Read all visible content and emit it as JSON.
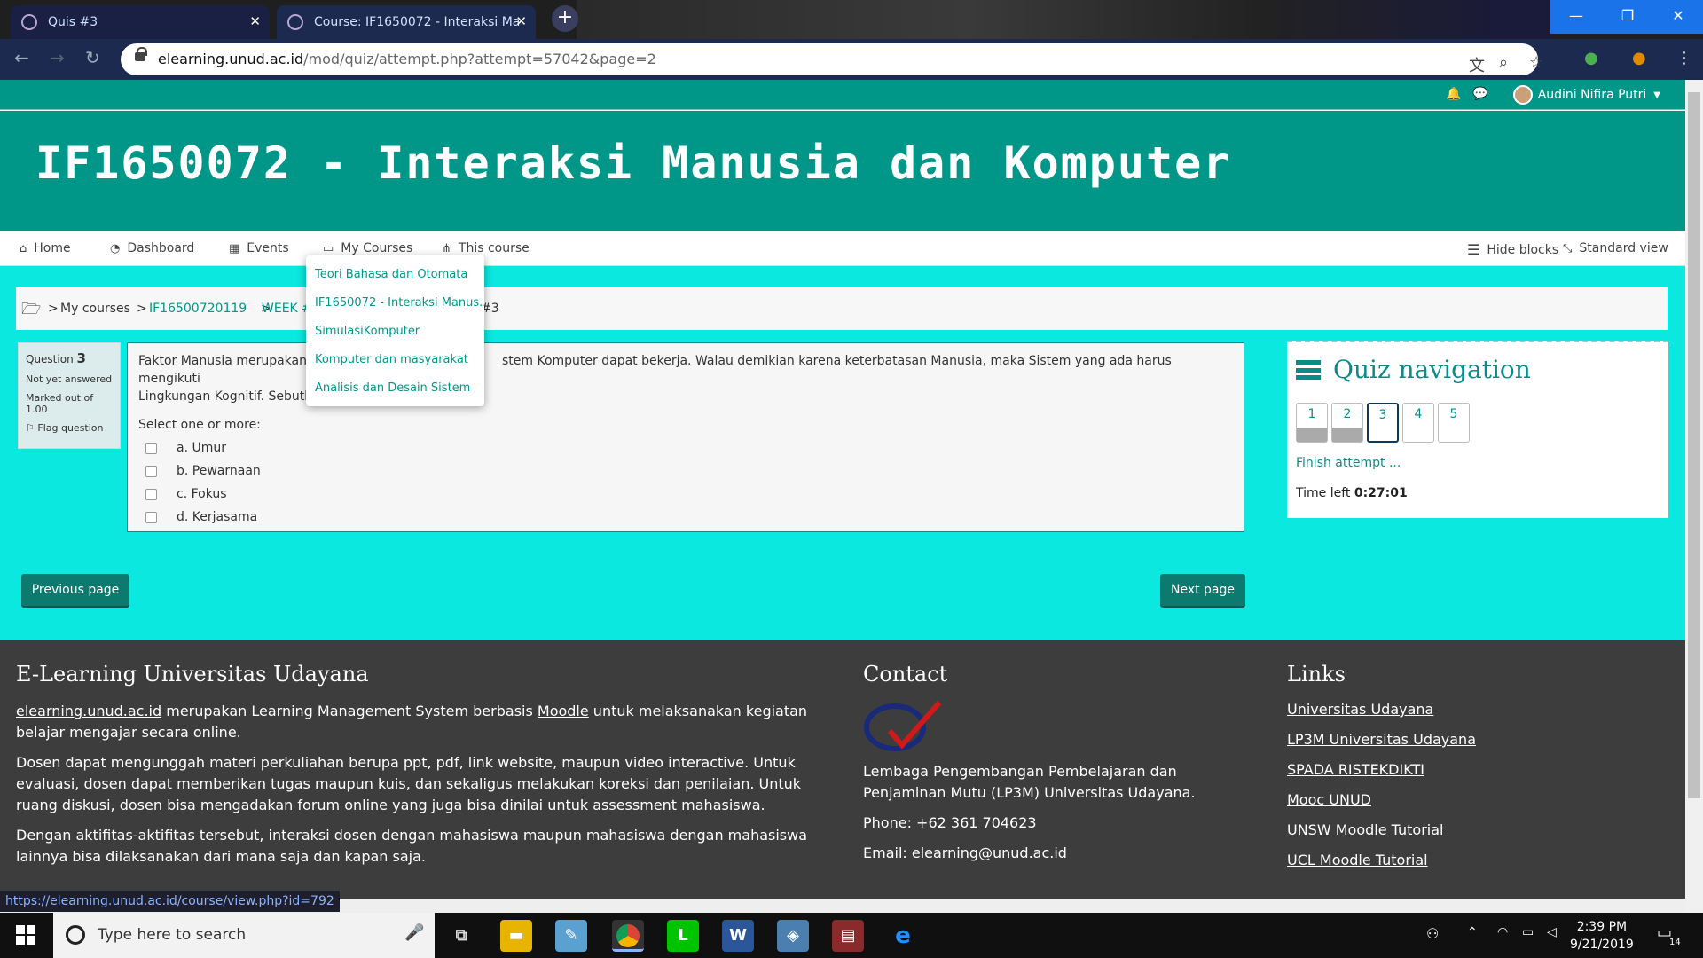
{
  "browser": {
    "tabs": [
      {
        "label": "Quis #3",
        "close": "✕"
      },
      {
        "label": "Course: IF1650072 - Interaksi Ma",
        "close": "✕"
      }
    ],
    "new_tab": "+",
    "url_domain": "elearning.unud.ac.id",
    "url_path": "/mod/quiz/attempt.php?attempt=57042&page=2",
    "window_buttons": {
      "min": "—",
      "max": "❐",
      "close": "✕"
    }
  },
  "topbar": {
    "user_name": "Audini Nifira Putri"
  },
  "header": {
    "course_title": "IF1650072 - Interaksi Manusia dan Komputer"
  },
  "nav": {
    "home": "Home",
    "dashboard": "Dashboard",
    "events": "Events",
    "my_courses": "My Courses",
    "this_course": "This course",
    "hide_blocks": "Hide blocks",
    "standard_view": "Standard view"
  },
  "dropdown": {
    "items": [
      "Teori Bahasa dan Otomata",
      "IF1650072 - Interaksi Manus...",
      "SimulasiKomputer",
      "Komputer dan masyarakat",
      "Analisis dan Desain Sistem"
    ]
  },
  "breadcrumb": {
    "sep": ">",
    "my_courses": "My courses",
    "course": "IF16500720119",
    "week": "WEEK #",
    "quiz": "#3"
  },
  "question": {
    "label": "Question",
    "number": "3",
    "status": "Not yet answered",
    "marked": "Marked out of 1.00",
    "flag": "Flag question",
    "text_part1": "Faktor Manusia merupakan",
    "text_part2": "stem Komputer dapat bekerja. Walau demikian karena keterbatasan Manusia, maka Sistem yang ada harus mengikuti",
    "text_line2": "Lingkungan Kognitif. Sebutk",
    "prompt": "Select one or more:",
    "options": [
      "a. Umur",
      "b. Pewarnaan",
      "c. Fokus",
      "d. Kerjasama"
    ]
  },
  "buttons": {
    "previous": "Previous page",
    "next": "Next page"
  },
  "quiz_nav": {
    "title": "Quiz navigation",
    "questions": [
      "1",
      "2",
      "3",
      "4",
      "5"
    ],
    "finish": "Finish attempt ...",
    "time_label": "Time left",
    "time_value": "0:27:01"
  },
  "footer": {
    "col1_title": "E-Learning Universitas Udayana",
    "p1_link": "elearning.unud.ac.id",
    "p1_mid": " merupakan Learning Management System berbasis ",
    "p1_moodle": "Moodle",
    "p1_end": " untuk melaksanakan kegiatan belajar mengajar secara online.",
    "p2": "Dosen dapat mengunggah materi perkuliahan berupa ppt, pdf, link website, maupun video interactive. Untuk evaluasi, dosen dapat memberikan tugas maupun kuis, dan sekaligus melakukan koreksi dan penilaian. Untuk ruang diskusi, dosen bisa mengadakan forum online yang juga bisa dinilai untuk assessment mahasiswa.",
    "p3": "Dengan aktifitas-aktifitas tersebut, interaksi dosen dengan mahasiswa maupun mahasiswa dengan mahasiswa lainnya bisa dilaksanakan dari mana saja dan kapan saja.",
    "col2_title": "Contact",
    "org": "Lembaga Pengembangan Pembelajaran dan Penjaminan Mutu (LP3M) Universitas Udayana.",
    "phone": "Phone: +62 361 704623",
    "email": "Email: elearning@unud.ac.id",
    "col3_title": "Links",
    "links": [
      "Universitas Udayana",
      "LP3M Universitas Udayana",
      "SPADA RISTEKDIKTI",
      "Mooc UNUD",
      "UNSW Moodle Tutorial",
      "UCL Moodle Tutorial"
    ]
  },
  "status_url": "https://elearning.unud.ac.id/course/view.php?id=792",
  "taskbar": {
    "search_placeholder": "Type here to search",
    "time": "2:39 PM",
    "date": "9/21/2019",
    "notif_count": "14"
  },
  "colors": {
    "teal": "#009688",
    "cyan_bg": "#0be8e0",
    "footer_bg": "#3d3d3d"
  }
}
